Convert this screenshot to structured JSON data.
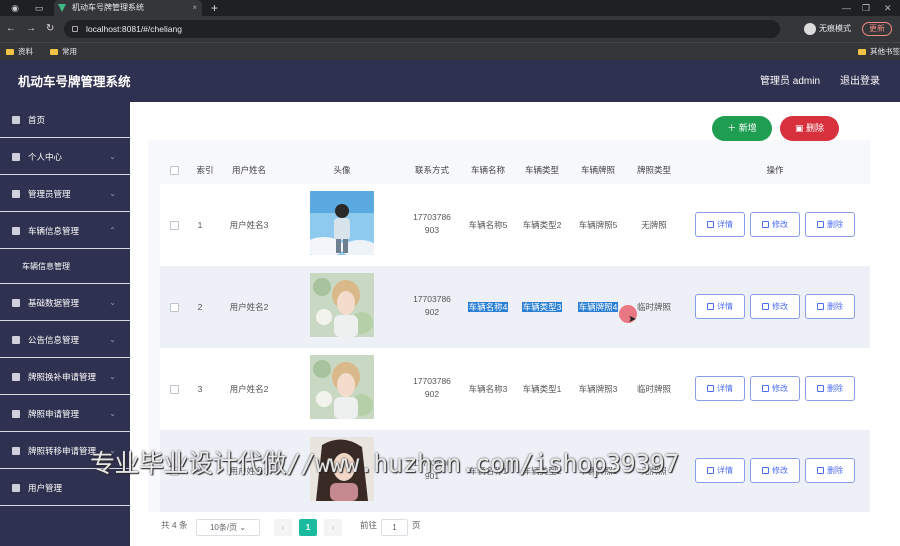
{
  "browser": {
    "tab_title": "机动车号牌管理系统",
    "url": "localhost:8081/#/cheliang",
    "incognito_label": "无痕模式",
    "update_label": "更新",
    "bookmarks": [
      "资料",
      "常用",
      "其他书签"
    ]
  },
  "header": {
    "app_title": "机动车号牌管理系统",
    "admin_label": "管理员 admin",
    "logout_label": "退出登录"
  },
  "sidebar": {
    "items": [
      {
        "label": "首页"
      },
      {
        "label": "个人中心"
      },
      {
        "label": "管理员管理"
      },
      {
        "label": "车辆信息管理"
      },
      {
        "label": "车辆信息管理"
      },
      {
        "label": "基础数据管理"
      },
      {
        "label": "公告信息管理"
      },
      {
        "label": "牌照换补申请管理"
      },
      {
        "label": "牌照申请管理"
      },
      {
        "label": "牌照转移申请管理"
      },
      {
        "label": "用户管理"
      }
    ]
  },
  "toolbar": {
    "add_label": "新增",
    "delete_label": "删除"
  },
  "table": {
    "headers": [
      "索引",
      "用户姓名",
      "头像",
      "联系方式",
      "车辆名称",
      "车辆类型",
      "车辆牌照",
      "牌照类型",
      "操作"
    ],
    "rows": [
      {
        "index": "1",
        "name": "用户姓名3",
        "phone1": "17703786",
        "phone2": "903",
        "car_name": "车辆名称5",
        "car_type": "车辆类型2",
        "plate": "车辆牌照5",
        "plate_type": "无牌照"
      },
      {
        "index": "2",
        "name": "用户姓名2",
        "phone1": "17703786",
        "phone2": "902",
        "car_name": "车辆名称4",
        "car_type": "车辆类型3",
        "plate": "车辆牌照4",
        "plate_type": "临时牌照"
      },
      {
        "index": "3",
        "name": "用户姓名2",
        "phone1": "17703786",
        "phone2": "902",
        "car_name": "车辆名称3",
        "car_type": "车辆类型1",
        "plate": "车辆牌照3",
        "plate_type": "临时牌照"
      },
      {
        "index": "4",
        "name": "用户姓名1",
        "phone1": "17703786",
        "phone2": "901",
        "car_name": "车辆名称1",
        "car_type": "车辆类型2",
        "plate": "车辆牌照1",
        "plate_type": "无牌照"
      }
    ],
    "actions": {
      "detail": "详情",
      "edit": "修改",
      "delete": "删除"
    }
  },
  "pagination": {
    "total": "共 4 条",
    "page_size": "10条/页",
    "prev": "‹",
    "current_page": "1",
    "next": "›",
    "goto_label": "前往",
    "goto_value": "1",
    "page_suffix": "页"
  },
  "watermark": "专业毕业设计代做//www.huzhan.com/ishop39397",
  "colors": {
    "nav_bg": "#2f3150",
    "add_btn": "#1f9e52",
    "del_btn": "#d6313d",
    "accent": "#4e6ef2",
    "page_active": "#1aba9f"
  }
}
